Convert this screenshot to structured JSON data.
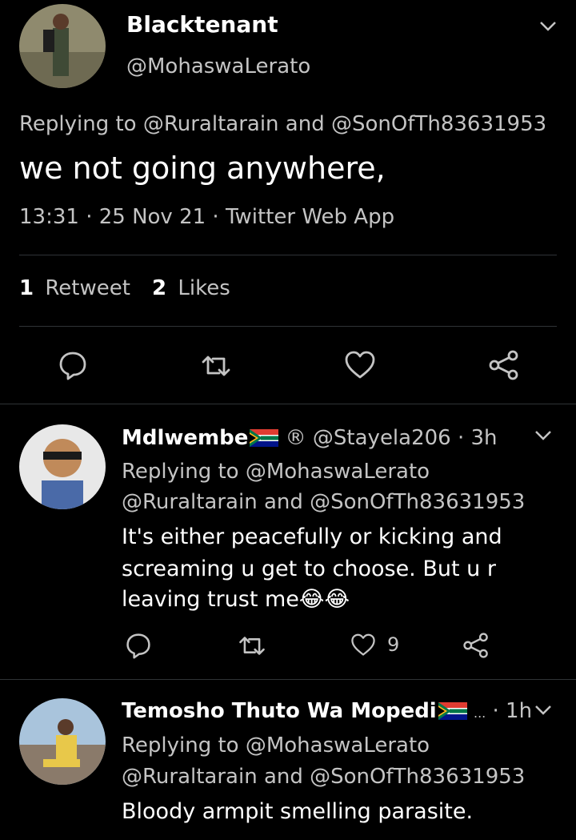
{
  "main_tweet": {
    "author_name": "Blacktenant",
    "handle": "@MohaswaLerato",
    "replying_to": "Replying to @Ruraltarain and @SonOfTh83631953",
    "text": "we not going anywhere,",
    "meta": "13:31 · 25 Nov 21 · Twitter Web App",
    "retweet_count": "1",
    "retweet_label": "Retweet",
    "like_count": "2",
    "like_label": "Likes"
  },
  "replies": [
    {
      "author_name": "Mdlwembe",
      "badge": "®",
      "handle": "@Stayela206",
      "time": "· 3h",
      "replying_line1": "Replying to @MohaswaLerato",
      "replying_line2": "@Ruraltarain and @SonOfTh83631953",
      "text_line1": "It's either peacefully or kicking and",
      "text_line2": "screaming u get to choose. But u r",
      "text_line3": "leaving trust me😂😂",
      "like_count": "9"
    },
    {
      "author_name": "Temosho Thuto Wa Mopedi",
      "badge": "...",
      "time": "· 1h",
      "replying_line1": "Replying to @MohaswaLerato",
      "replying_line2": "@Ruraltarain and @SonOfTh83631953",
      "text_line1": "Bloody armpit smelling parasite."
    }
  ],
  "colors": {
    "background": "#000000",
    "text": "#ffffff",
    "secondary": "#c4c4c4",
    "divider": "#2f3336"
  }
}
